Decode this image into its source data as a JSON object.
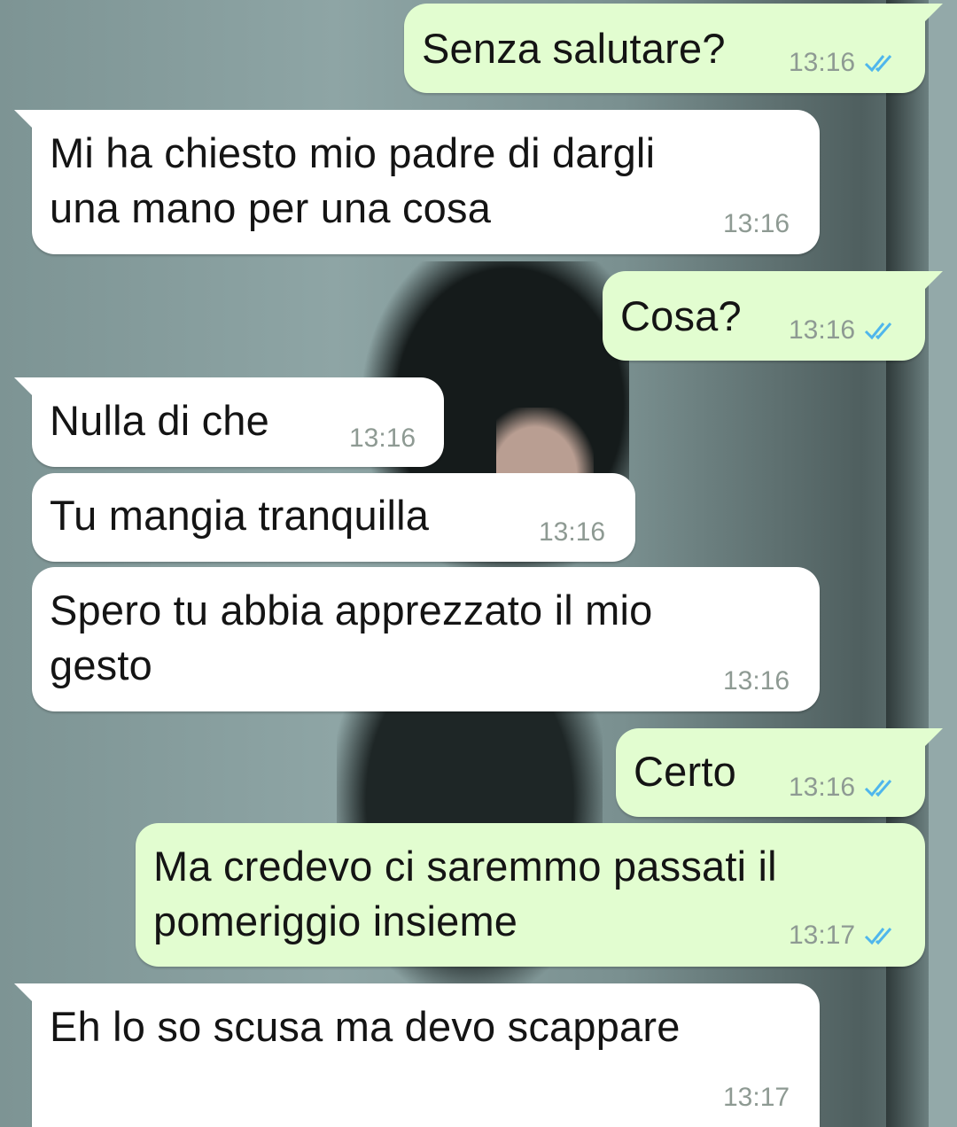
{
  "messages": [
    {
      "id": "m1",
      "text": "Senza salutare?",
      "time": "13:16",
      "direction": "outgoing",
      "status": "read"
    },
    {
      "id": "m2",
      "text": "Mi ha chiesto mio padre di dargli\nuna mano per una cosa",
      "time": "13:16",
      "direction": "incoming"
    },
    {
      "id": "m3",
      "text": "Cosa?",
      "time": "13:16",
      "direction": "outgoing",
      "status": "read"
    },
    {
      "id": "m4",
      "text": "Nulla di che",
      "time": "13:16",
      "direction": "incoming"
    },
    {
      "id": "m5",
      "text": "Tu mangia tranquilla",
      "time": "13:16",
      "direction": "incoming"
    },
    {
      "id": "m6",
      "text": "Spero tu abbia apprezzato il mio\ngesto",
      "time": "13:16",
      "direction": "incoming"
    },
    {
      "id": "m7",
      "text": "Certo",
      "time": "13:16",
      "direction": "outgoing",
      "status": "read"
    },
    {
      "id": "m8",
      "text": "Ma credevo ci saremmo passati il\npomeriggio insieme",
      "time": "13:17",
      "direction": "outgoing",
      "status": "read"
    },
    {
      "id": "m9",
      "text": "Eh lo so scusa ma devo scappare",
      "time": "13:17",
      "direction": "incoming"
    }
  ],
  "colors": {
    "outgoing_bubble": "#e2fdd0",
    "incoming_bubble": "#ffffff",
    "read_tick": "#4fb6ec",
    "timestamp": "#8e9a93"
  },
  "icons": {
    "read_receipt": "double-check-icon"
  }
}
